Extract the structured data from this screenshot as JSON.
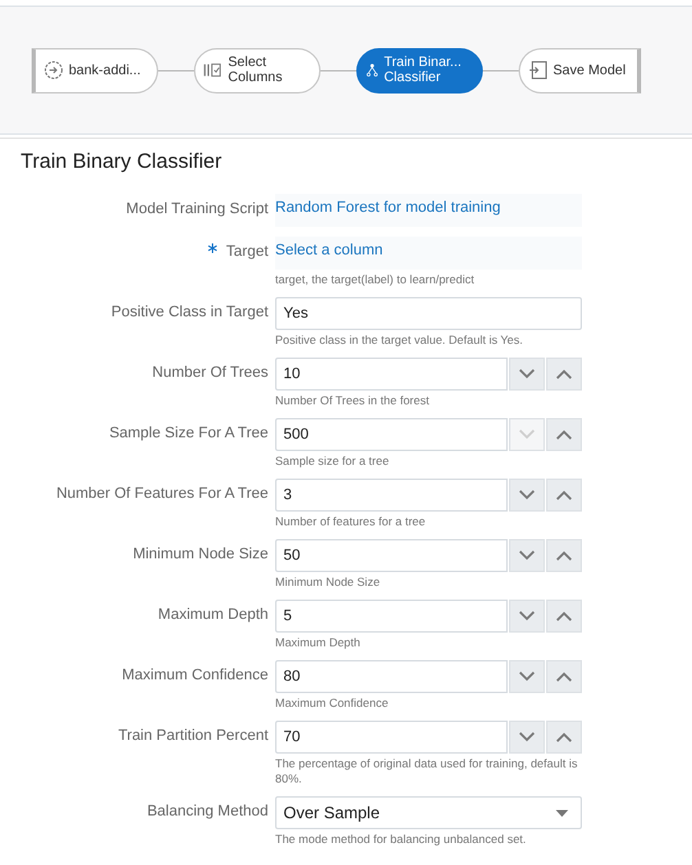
{
  "pipeline": {
    "nodes": [
      {
        "kind": "source",
        "label": "bank-addi...",
        "selected": false
      },
      {
        "kind": "columns",
        "label": "Select Columns",
        "selected": false
      },
      {
        "kind": "tree",
        "label": "Train Binar... Classifier",
        "selected": true
      },
      {
        "kind": "save",
        "label": "Save Model",
        "selected": false
      }
    ]
  },
  "panel": {
    "title": "Train Binary Classifier",
    "fields": [
      {
        "kind": "link",
        "label": "Model Training Script",
        "value": "Random Forest for model training",
        "required": false
      },
      {
        "kind": "link",
        "label": "Target",
        "value": "Select a column",
        "required": true,
        "hint": "target, the target(label) to learn/predict"
      },
      {
        "kind": "text",
        "label": "Positive Class in Target",
        "value": "Yes",
        "required": false,
        "hint": "Positive class in the target value. Default is Yes."
      },
      {
        "kind": "number",
        "label": "Number Of Trees",
        "value": "10",
        "required": false,
        "hint": "Number Of Trees in the forest",
        "down_disabled": false
      },
      {
        "kind": "number",
        "label": "Sample Size For A Tree",
        "value": "500",
        "required": false,
        "hint": "Sample size for a tree",
        "down_disabled": true
      },
      {
        "kind": "number",
        "label": "Number Of Features For A Tree",
        "value": "3",
        "required": false,
        "hint": "Number of features for a tree",
        "down_disabled": false
      },
      {
        "kind": "number",
        "label": "Minimum Node Size",
        "value": "50",
        "required": false,
        "hint": "Minimum Node Size",
        "down_disabled": false
      },
      {
        "kind": "number",
        "label": "Maximum Depth",
        "value": "5",
        "required": false,
        "hint": "Maximum Depth",
        "down_disabled": false
      },
      {
        "kind": "number",
        "label": "Maximum Confidence",
        "value": "80",
        "required": false,
        "hint": "Maximum Confidence",
        "down_disabled": false
      },
      {
        "kind": "number",
        "label": "Train Partition Percent",
        "value": "70",
        "required": false,
        "hint": "The percentage of original data used for training, default is 80%.",
        "down_disabled": false
      },
      {
        "kind": "select",
        "label": "Balancing Method",
        "value": "Over Sample",
        "required": false,
        "hint": "The mode method for balancing unbalanced set."
      }
    ]
  }
}
